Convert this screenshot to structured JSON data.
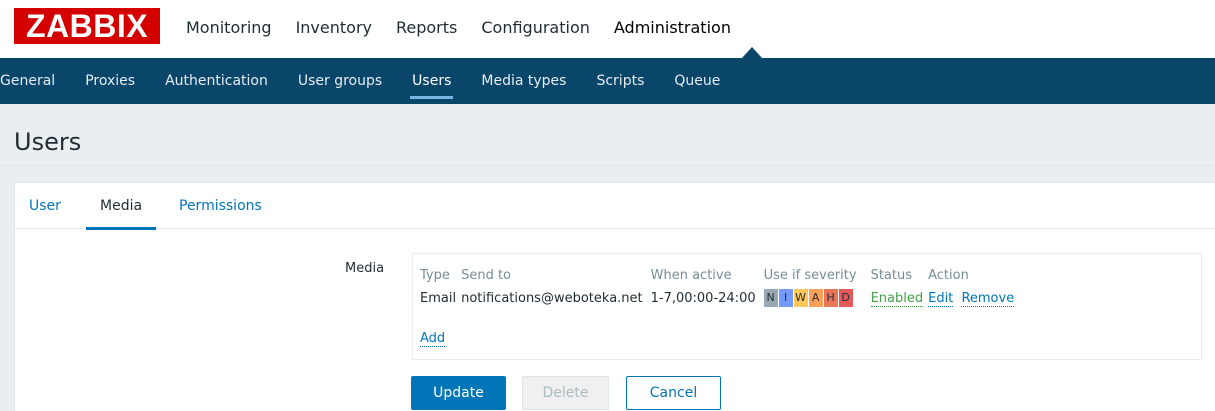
{
  "app": {
    "logo": "ZABBIX"
  },
  "top_nav": [
    {
      "label": "Monitoring"
    },
    {
      "label": "Inventory"
    },
    {
      "label": "Reports"
    },
    {
      "label": "Configuration"
    },
    {
      "label": "Administration",
      "active": true
    }
  ],
  "sub_nav": [
    {
      "label": "General"
    },
    {
      "label": "Proxies"
    },
    {
      "label": "Authentication"
    },
    {
      "label": "User groups"
    },
    {
      "label": "Users",
      "active": true
    },
    {
      "label": "Media types"
    },
    {
      "label": "Scripts"
    },
    {
      "label": "Queue"
    }
  ],
  "page": {
    "title": "Users"
  },
  "tabs": [
    {
      "label": "User"
    },
    {
      "label": "Media",
      "active": true
    },
    {
      "label": "Permissions"
    }
  ],
  "media": {
    "field_label": "Media",
    "columns": [
      "Type",
      "Send to",
      "When active",
      "Use if severity",
      "Status",
      "Action"
    ],
    "rows": [
      {
        "type": "Email",
        "send_to": "notifications@weboteka.net",
        "when_active": "1-7,00:00-24:00",
        "severity": [
          "N",
          "I",
          "W",
          "A",
          "H",
          "D"
        ],
        "status": "Enabled",
        "action_edit": "Edit",
        "action_remove": "Remove"
      }
    ],
    "add_label": "Add"
  },
  "buttons": {
    "update": "Update",
    "delete": "Delete",
    "cancel": "Cancel"
  },
  "colors": {
    "brand_red": "#d40000",
    "nav_dark": "#0a466a",
    "link_blue": "#0275b8",
    "status_green": "#429e47",
    "severity_not_classified": "#97aab3",
    "severity_information": "#7499ff",
    "severity_warning": "#ffc859",
    "severity_average": "#ffa059",
    "severity_high": "#e97659",
    "severity_disaster": "#e45959"
  }
}
